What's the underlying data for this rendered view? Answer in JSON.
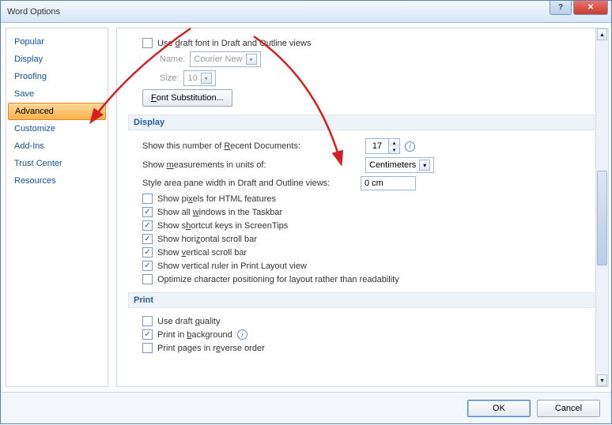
{
  "title": "Word Options",
  "sidebar": {
    "items": [
      {
        "label": "Popular"
      },
      {
        "label": "Display"
      },
      {
        "label": "Proofing"
      },
      {
        "label": "Save"
      },
      {
        "label": "Advanced",
        "selected": true
      },
      {
        "label": "Customize"
      },
      {
        "label": "Add-Ins"
      },
      {
        "label": "Trust Center"
      },
      {
        "label": "Resources"
      }
    ]
  },
  "top": {
    "use_draft_font": "Use draft font in Draft and Outline views",
    "name_label": "Name:",
    "name_value": "Courier New",
    "size_label": "Size:",
    "size_value": "10",
    "font_sub": "Font Substitution..."
  },
  "display": {
    "header": "Display",
    "recent_label": "Show this number of Recent Documents:",
    "recent_value": "17",
    "units_label": "Show measurements in units of:",
    "units_value": "Centimeters",
    "style_pane_label": "Style area pane width in Draft and Outline views:",
    "style_pane_value": "0 cm",
    "chk_pixels": "Show pixels for HTML features",
    "chk_windows": "Show all windows in the Taskbar",
    "chk_shortcut": "Show shortcut keys in ScreenTips",
    "chk_hscroll": "Show horizontal scroll bar",
    "chk_vscroll": "Show vertical scroll bar",
    "chk_vruler": "Show vertical ruler in Print Layout view",
    "chk_optimize": "Optimize character positioning for layout rather than readability"
  },
  "print": {
    "header": "Print",
    "chk_draft": "Use draft quality",
    "chk_bg": "Print in background",
    "chk_reverse": "Print pages in reverse order"
  },
  "footer": {
    "ok": "OK",
    "cancel": "Cancel"
  }
}
